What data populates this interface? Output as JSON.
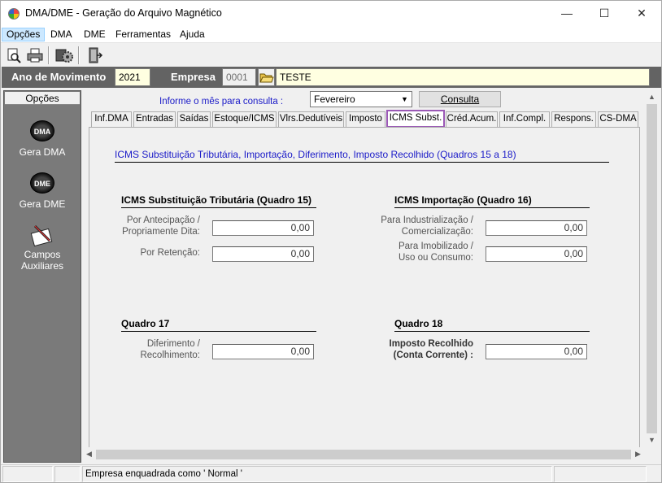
{
  "window": {
    "title": "DMA/DME - Geração do Arquivo Magnético",
    "minimize": "—",
    "maximize": "☐",
    "close": "✕"
  },
  "menu": [
    "Opções",
    "DMA",
    "DME",
    "Ferramentas",
    "Ajuda"
  ],
  "header": {
    "ano_label": "Ano de Movimento",
    "ano_value": "2021",
    "empresa_label": "Empresa",
    "empresa_code": "0001",
    "empresa_name": "TESTE"
  },
  "sidebar": {
    "title": "Opções",
    "items": [
      {
        "icon_text": "DMA",
        "label": "Gera DMA"
      },
      {
        "icon_text": "DME",
        "label": "Gera DME"
      },
      {
        "label": "Campos Auxiliares"
      }
    ]
  },
  "consulta": {
    "label": "Informe o mês para consulta :",
    "month": "Fevereiro",
    "button": "Consulta"
  },
  "tabs": [
    "Inf.DMA",
    "Entradas",
    "Saídas",
    "Estoque/ICMS",
    "Vlrs.Dedutíveis",
    "Imposto",
    "ICMS Subst.",
    "Créd.Acum.",
    "Inf.Compl.",
    "Respons.",
    "CS-DMA"
  ],
  "active_tab": "ICMS Subst.",
  "panel": {
    "title": "ICMS Substituição Tributária, Importação, Diferimento, Imposto Recolhido (Quadros 15 a 18)",
    "q15": {
      "heading": "ICMS Substituição Tributária (Quadro 15)",
      "f1_label_1": "Por Antecipação /",
      "f1_label_2": "Propriamente Dita:",
      "f1_value": "0,00",
      "f2_label": "Por Retenção:",
      "f2_value": "0,00"
    },
    "q16": {
      "heading": "ICMS Importação (Quadro 16)",
      "f1_label_1": "Para Industrialização /",
      "f1_label_2": "Comercialização:",
      "f1_value": "0,00",
      "f2_label_1": "Para Imobilizado /",
      "f2_label_2": "Uso ou Consumo:",
      "f2_value": "0,00"
    },
    "q17": {
      "heading": "Quadro 17",
      "f1_label_1": "Diferimento /",
      "f1_label_2": "Recolhimento:",
      "f1_value": "0,00"
    },
    "q18": {
      "heading": "Quadro 18",
      "f1_label_1": "Imposto Recolhido",
      "f1_label_2": "(Conta Corrente) :",
      "f1_value": "0,00"
    }
  },
  "status": {
    "message": "Empresa enquadrada como ' Normal '"
  }
}
